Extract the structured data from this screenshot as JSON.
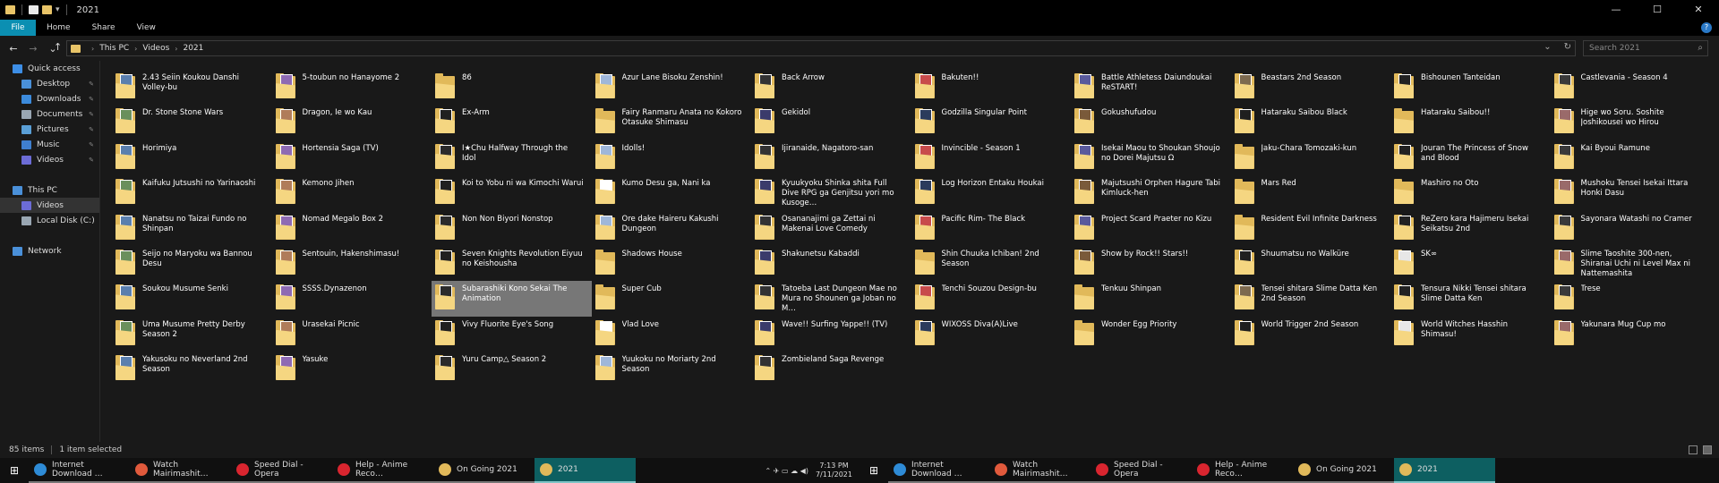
{
  "window": {
    "title": "2021",
    "minimize": "—",
    "maximize": "☐",
    "close": "✕"
  },
  "ribbon": {
    "tabs": [
      "File",
      "Home",
      "Share",
      "View"
    ],
    "help": "?"
  },
  "address": {
    "crumbs": [
      "This PC",
      "Videos",
      "2021"
    ],
    "dropdown": "⌄",
    "refresh": "↻"
  },
  "search": {
    "placeholder": "Search 2021"
  },
  "sidebar": {
    "items": [
      {
        "label": "Quick access",
        "icon": "star-icon",
        "color": "#3d8ee6",
        "indent": 0,
        "pinned": false
      },
      {
        "label": "Desktop",
        "icon": "desktop-icon",
        "color": "#4a90d9",
        "indent": 1,
        "pinned": true
      },
      {
        "label": "Downloads",
        "icon": "download-icon",
        "color": "#3c8bdc",
        "indent": 1,
        "pinned": true
      },
      {
        "label": "Documents",
        "icon": "documents-icon",
        "color": "#9aa7b3",
        "indent": 1,
        "pinned": true
      },
      {
        "label": "Pictures",
        "icon": "pictures-icon",
        "color": "#5a9fd6",
        "indent": 1,
        "pinned": true
      },
      {
        "label": "Music",
        "icon": "music-icon",
        "color": "#3f7fcf",
        "indent": 1,
        "pinned": true
      },
      {
        "label": "Videos",
        "icon": "videos-icon",
        "color": "#6c6cd6",
        "indent": 1,
        "pinned": true
      },
      {
        "label": "",
        "icon": "",
        "color": "",
        "indent": 0,
        "pinned": false
      },
      {
        "label": "This PC",
        "icon": "computer-icon",
        "color": "#4a90d9",
        "indent": 0,
        "pinned": false
      },
      {
        "label": "Videos",
        "icon": "videos-icon",
        "color": "#6c6cd6",
        "indent": 1,
        "pinned": false
      },
      {
        "label": "Local Disk (C:)",
        "icon": "disk-icon",
        "color": "#9aa7b3",
        "indent": 1,
        "pinned": false
      },
      {
        "label": "",
        "icon": "",
        "color": "",
        "indent": 0,
        "pinned": false
      },
      {
        "label": "Network",
        "icon": "network-icon",
        "color": "#4a90d9",
        "indent": 0,
        "pinned": false
      }
    ],
    "selected_index": 9
  },
  "folders": [
    "2.43 Seiin Koukou Danshi Volley-bu",
    "5-toubun no Hanayome 2",
    "86",
    "Azur Lane Bisoku Zenshin!",
    "Back Arrow",
    "Bakuten!!",
    "Battle Athletess Daiundoukai ReSTART!",
    "Beastars 2nd Season",
    "Bishounen Tanteidan",
    "Castlevania - Season 4",
    "Dr. Stone Stone Wars",
    "Dragon, Ie wo Kau",
    "Ex-Arm",
    "Fairy Ranmaru Anata no Kokoro Otasuke Shimasu",
    "Gekidol",
    "Godzilla Singular Point",
    "Gokushufudou",
    "Hataraku Saibou Black",
    "Hataraku Saibou!!",
    "Hige wo Soru. Soshite Joshikousei wo Hirou",
    "Horimiya",
    "Hortensia Saga (TV)",
    "I★Chu Halfway Through the Idol",
    "Idolls!",
    "Ijiranaide, Nagatoro-san",
    "Invincible - Season 1",
    "Isekai Maou to Shoukan Shoujo no Dorei Majutsu Ω",
    "Jaku-Chara Tomozaki-kun",
    "Jouran The Princess of Snow and Blood",
    "Kai Byoui Ramune",
    "Kaifuku Jutsushi no Yarinaoshi",
    "Kemono Jihen",
    "Koi to Yobu ni wa Kimochi Warui",
    "Kumo Desu ga, Nani ka",
    "Kyuukyoku Shinka shita Full Dive RPG ga Genjitsu yori mo Kusoge…",
    "Log Horizon Entaku Houkai",
    "Majutsushi Orphen Hagure Tabi Kimluck-hen",
    "Mars Red",
    "Mashiro no Oto",
    "Mushoku Tensei Isekai Ittara Honki Dasu",
    "Nanatsu no Taizai Fundo no Shinpan",
    "Nomad Megalo Box 2",
    "Non Non Biyori Nonstop",
    "Ore dake Haireru Kakushi Dungeon",
    "Osananajimi ga Zettai ni Makenai Love Comedy",
    "Pacific Rim- The Black",
    "Project Scard Praeter no Kizu",
    "Resident Evil Infinite Darkness",
    "ReZero kara Hajimeru Isekai Seikatsu 2nd",
    "Sayonara Watashi no Cramer",
    "Seijo no Maryoku wa Bannou Desu",
    "Sentouin, Hakenshimasu!",
    "Seven Knights Revolution Eiyuu no Keishousha",
    "Shadows House",
    "Shakunetsu Kabaddi",
    "Shin Chuuka Ichiban! 2nd Season",
    "Show by Rock!! Stars!!",
    "Shuumatsu no Walküre",
    "SK∞",
    "Slime Taoshite 300-nen, Shiranai Uchi ni Level Max ni Nattemashita",
    "Soukou Musume Senki",
    "SSSS.Dynazenon",
    "Subarashiki Kono Sekai The Animation",
    "Super Cub",
    "Tatoeba Last Dungeon Mae no Mura no Shounen ga Joban no M…",
    "Tenchi Souzou Design-bu",
    "Tenkuu Shinpan",
    "Tensei shitara Slime Datta Ken 2nd Season",
    "Tensura Nikki Tensei shitara Slime Datta Ken",
    "Trese",
    "Uma Musume Pretty Derby Season 2",
    "Urasekai Picnic",
    "Vivy Fluorite Eye's Song",
    "Vlad Love",
    "Wave!! Surfing Yappe!! (TV)",
    "WIXOSS Diva(A)Live",
    "Wonder Egg Priority",
    "World Trigger 2nd Season",
    "World Witches Hasshin Shimasu!",
    "Yakunara Mug Cup mo",
    "Yakusoku no Neverland 2nd Season",
    "Yasuke",
    "Yuru Camp△ Season 2",
    "Yuukoku no Moriarty 2nd Season",
    "Zombieland Saga Revenge"
  ],
  "art_colors": [
    "#5a7fae",
    "#8e6ab3",
    "#2b2b2b",
    "#9fb7d9",
    "#333333",
    "#c84b4b",
    "#5a5a9c",
    "#7d6a4f",
    "#222222",
    "#3a3a3a",
    "#6a8f5c",
    "#b07c5a",
    "#202020",
    "#ffffff",
    "#3b3b6b",
    "#2b3b5c",
    "#7a5a3a",
    "#1f1f1f",
    "#e7e7e7",
    "#9a6a6a"
  ],
  "no_art": [
    2,
    13,
    18,
    27,
    37,
    38,
    47,
    53,
    55,
    63,
    66,
    76
  ],
  "selected_folder": 62,
  "status": {
    "count": "85 items",
    "selection": "1 item selected"
  },
  "taskbar": {
    "start": "⊞",
    "items": [
      {
        "label": "Internet Download …",
        "color": "#2e8bd6",
        "active": false
      },
      {
        "label": "Watch Mairimashit…",
        "color": "#e15a3c",
        "active": false
      },
      {
        "label": "Speed Dial - Opera",
        "color": "#d9252f",
        "active": false
      },
      {
        "label": "Help - Anime Reco…",
        "color": "#d9252f",
        "active": false
      },
      {
        "label": "On Going 2021",
        "color": "#e1b95a",
        "active": false
      },
      {
        "label": "2021",
        "color": "#e1b95a",
        "active": true
      }
    ],
    "tray": {
      "icons": "⌃ ✈ ▭ ☁ ◀)",
      "time": "7:13 PM",
      "date": "7/11/2021"
    }
  }
}
